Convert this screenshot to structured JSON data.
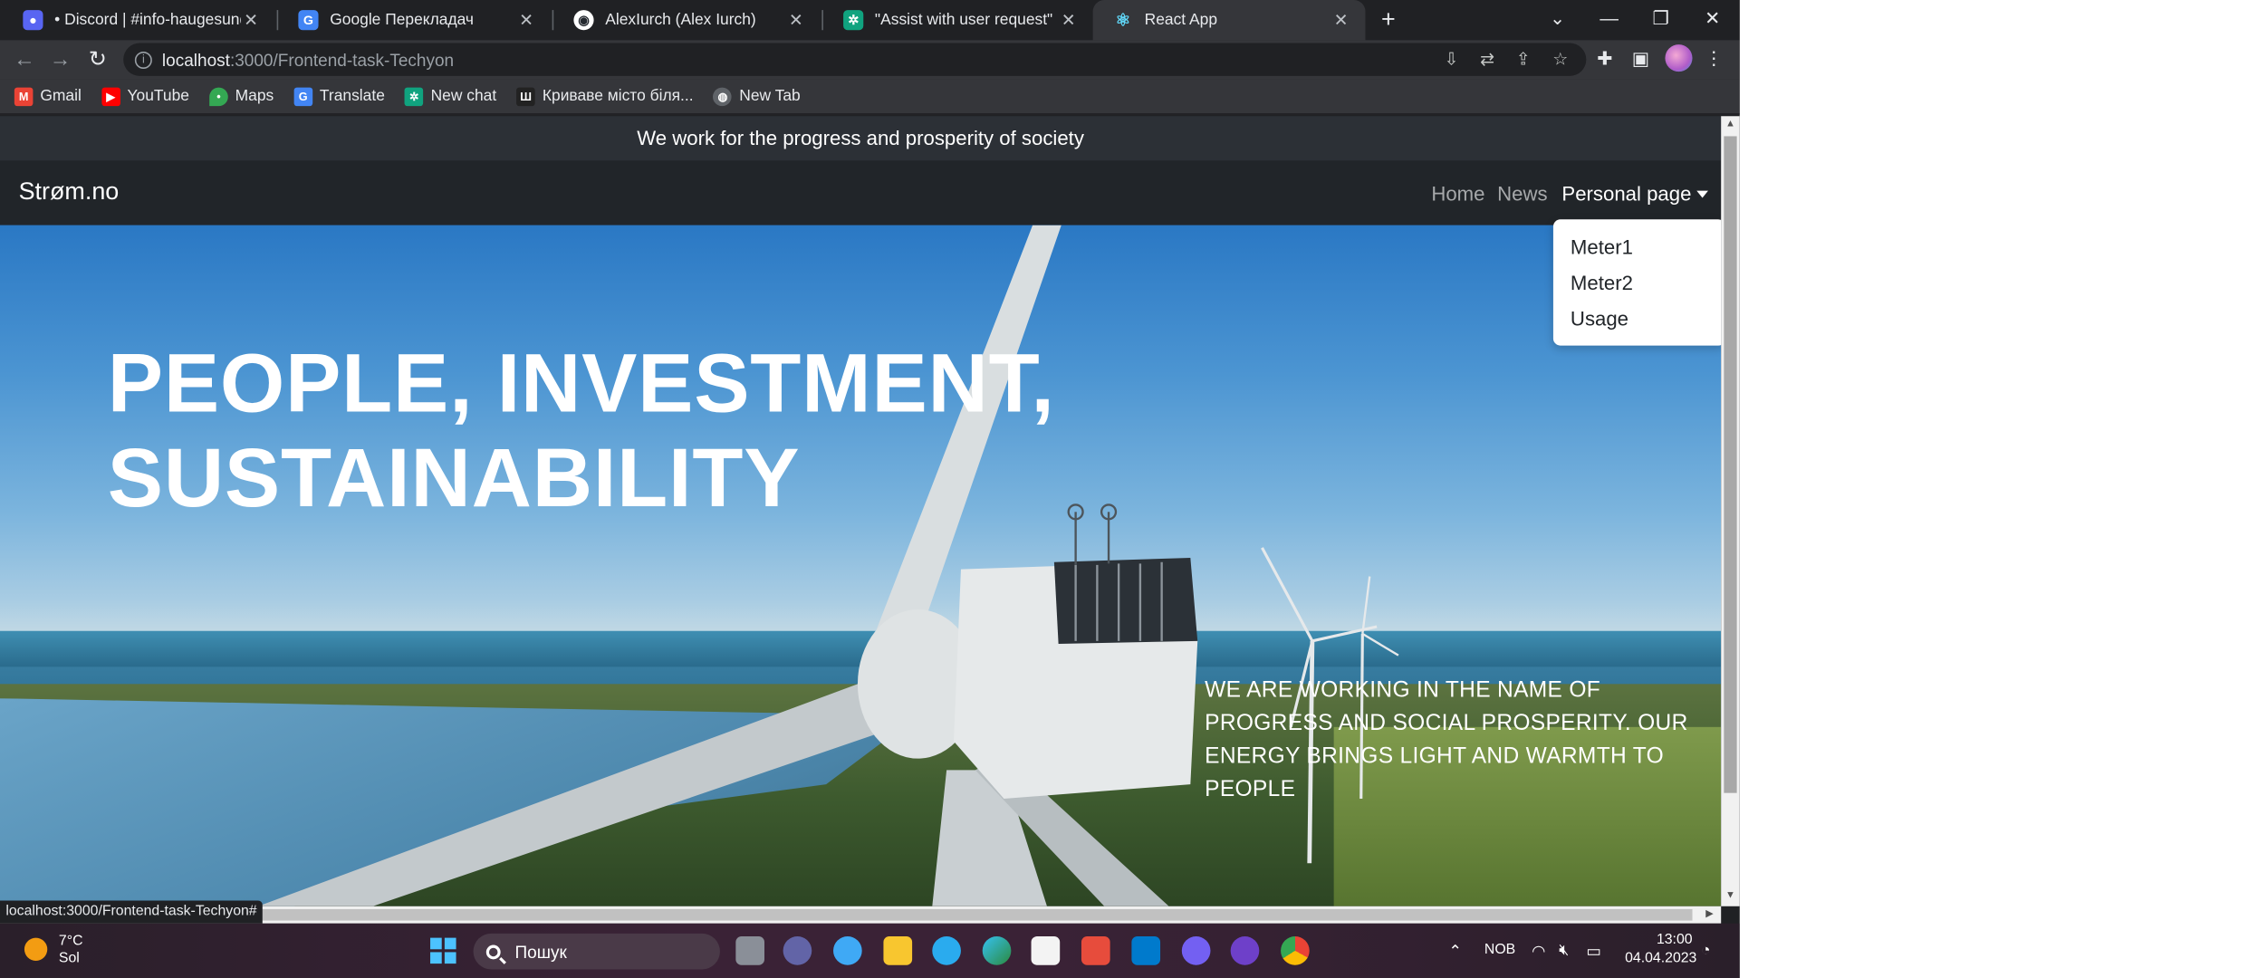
{
  "browser": {
    "tabs": [
      {
        "title": "• Discord | #info-haugesund | IT",
        "favicon": "discord-icon",
        "color": "#5865f2",
        "active": false
      },
      {
        "title": "Google Перекладач",
        "favicon": "translate-icon",
        "color": "#4285f4",
        "active": false
      },
      {
        "title": "AlexIurch (Alex Iurch)",
        "favicon": "github-icon",
        "color": "#24292f",
        "active": false
      },
      {
        "title": "\"Assist with user request\"",
        "favicon": "chatgpt-icon",
        "color": "#10a37f",
        "active": false
      },
      {
        "title": "React App",
        "favicon": "react-icon",
        "color": "#61dafb",
        "active": true
      }
    ],
    "address": {
      "host": "localhost",
      "path": ":3000/Frontend-task-Techyon"
    },
    "bookmarks": [
      {
        "label": "Gmail",
        "icon": "gmail-icon",
        "color": "#ea4335"
      },
      {
        "label": "YouTube",
        "icon": "youtube-icon",
        "color": "#ff0000"
      },
      {
        "label": "Maps",
        "icon": "maps-icon",
        "color": "#34a853"
      },
      {
        "label": "Translate",
        "icon": "translate-icon",
        "color": "#4285f4"
      },
      {
        "label": "New chat",
        "icon": "chatgpt-icon",
        "color": "#10a37f"
      },
      {
        "label": "Криваве місто біля...",
        "icon": "site-icon",
        "color": "#222222"
      },
      {
        "label": "New Tab",
        "icon": "globe-icon",
        "color": "#5f6368"
      }
    ],
    "status_url": "localhost:3000/Frontend-task-Techyon#"
  },
  "site": {
    "banner": "We work for the progress and prosperity of society",
    "brand": "Strøm.no",
    "nav": {
      "home": "Home",
      "news": "News",
      "personal": "Personal page"
    },
    "dropdown": [
      "Meter1",
      "Meter2",
      "Usage"
    ],
    "hero": {
      "title_line1": "PEOPLE, INVESTMENT,",
      "title_line2": "SUSTAINABILITY",
      "text": "WE ARE WORKING IN THE NAME OF PROGRESS AND SOCIAL PROSPERITY. OUR ENERGY BRINGS LIGHT AND WARMTH TO PEOPLE"
    }
  },
  "taskbar": {
    "weather_temp": "7°C",
    "weather_desc": "Sol",
    "search_placeholder": "Пошук",
    "language": "NOB",
    "time": "13:00",
    "date": "04.04.2023"
  }
}
